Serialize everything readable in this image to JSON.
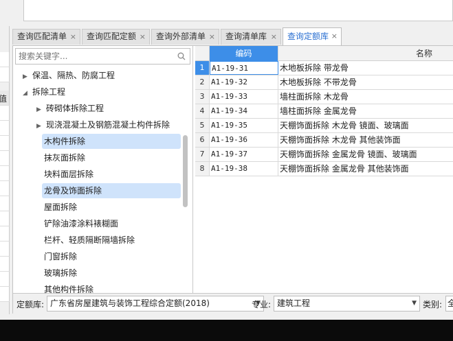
{
  "left_strip": {
    "header_char": "值"
  },
  "tabs": [
    {
      "label": "查询匹配清单",
      "active": false
    },
    {
      "label": "查询匹配定额",
      "active": false
    },
    {
      "label": "查询外部清单",
      "active": false
    },
    {
      "label": "查询清单库",
      "active": false
    },
    {
      "label": "查询定额库",
      "active": true
    }
  ],
  "tab_close_glyph": "×",
  "search": {
    "placeholder": "搜索关键字..."
  },
  "tree": [
    {
      "label": "保温、隔热、防腐工程",
      "level": 0,
      "expanded": false,
      "has_children": true,
      "selected": false
    },
    {
      "label": "拆除工程",
      "level": 0,
      "expanded": true,
      "has_children": true,
      "selected": false
    },
    {
      "label": "砖砌体拆除工程",
      "level": 1,
      "expanded": false,
      "has_children": true,
      "selected": false
    },
    {
      "label": "现浇混凝土及钢筋混凝土构件拆除",
      "level": 1,
      "expanded": false,
      "has_children": true,
      "selected": false
    },
    {
      "label": "木构件拆除",
      "level": 2,
      "has_children": false,
      "selected": true
    },
    {
      "label": "抹灰面拆除",
      "level": 2,
      "has_children": false,
      "selected": false
    },
    {
      "label": "块料面层拆除",
      "level": 2,
      "has_children": false,
      "selected": false
    },
    {
      "label": "龙骨及饰面拆除",
      "level": 2,
      "has_children": false,
      "selected": true
    },
    {
      "label": "屋面拆除",
      "level": 2,
      "has_children": false,
      "selected": false
    },
    {
      "label": "铲除油漆涂料裱糊面",
      "level": 2,
      "has_children": false,
      "selected": false
    },
    {
      "label": "栏杆、轻质隔断隔墙拆除",
      "level": 2,
      "has_children": false,
      "selected": false
    },
    {
      "label": "门窗拆除",
      "level": 2,
      "has_children": false,
      "selected": false
    },
    {
      "label": "玻璃拆除",
      "level": 2,
      "has_children": false,
      "selected": false
    },
    {
      "label": "其他构件拆除",
      "level": 2,
      "has_children": false,
      "selected": false
    }
  ],
  "grid": {
    "columns": [
      "编码",
      "名称"
    ],
    "rows": [
      {
        "idx": "1",
        "code": "A1-19-31",
        "name": "木地板拆除 带龙骨"
      },
      {
        "idx": "2",
        "code": "A1-19-32",
        "name": "木地板拆除 不带龙骨"
      },
      {
        "idx": "3",
        "code": "A1-19-33",
        "name": "墙柱面拆除 木龙骨"
      },
      {
        "idx": "4",
        "code": "A1-19-34",
        "name": "墙柱面拆除 金属龙骨"
      },
      {
        "idx": "5",
        "code": "A1-19-35",
        "name": "天棚饰面拆除 木龙骨 镜面、玻璃面"
      },
      {
        "idx": "6",
        "code": "A1-19-36",
        "name": "天棚饰面拆除 木龙骨 其他装饰面"
      },
      {
        "idx": "7",
        "code": "A1-19-37",
        "name": "天棚饰面拆除 金属龙骨 镜面、玻璃面"
      },
      {
        "idx": "8",
        "code": "A1-19-38",
        "name": "天棚饰面拆除 金属龙骨 其他装饰面"
      }
    ]
  },
  "footer": {
    "quota_label": "定额库:",
    "quota_value": "广东省房屋建筑与装饰工程综合定额(2018)",
    "major_label": "专业:",
    "major_value": "建筑工程",
    "category_label": "类别:",
    "category_value": "全"
  },
  "colors": {
    "accent": "#3d8ee8",
    "selection": "#cfe3fb",
    "active_tab_text": "#2a6fd1"
  }
}
